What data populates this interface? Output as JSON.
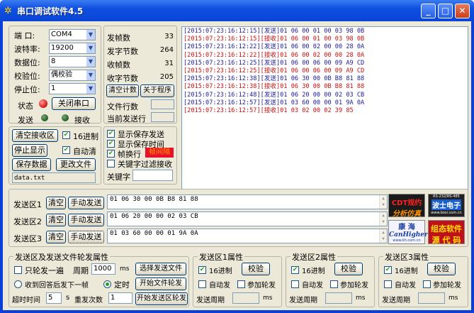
{
  "window": {
    "title": "串口调试软件4.5",
    "icon": "app-icon"
  },
  "port": {
    "labels": {
      "port": "端  口:",
      "baud": "波特率:",
      "databits": "数据位:",
      "parity": "校验位:",
      "stopbits": "停止位:",
      "state": "状态",
      "send": "发送",
      "recv": "接收"
    },
    "values": {
      "port": "COM4",
      "baud": "19200",
      "databits": "8",
      "parity": "偶校验",
      "stopbits": "1"
    },
    "close_button": "关闭串口",
    "state_color": "#e02020",
    "led_color": "#2a6a2a"
  },
  "stats": {
    "send_frames_label": "发帧数",
    "send_frames": "33",
    "send_bytes_label": "发字节数",
    "send_bytes": "264",
    "recv_frames_label": "收帧数",
    "recv_frames": "31",
    "recv_bytes_label": "收字节数",
    "recv_bytes": "205",
    "clear_button": "清空计数",
    "about_button": "关于程序",
    "file_lines_label": "文件行数",
    "current_line_label": "当前发送行"
  },
  "recv_controls": {
    "clear_recv": "清空接收区",
    "hex16": "16进制",
    "stop_display": "停止显示",
    "auto_clear": "自动清",
    "save_data": "保存数据",
    "change_file": "更改文件",
    "filename": "data.txt"
  },
  "display_options": {
    "show_save_send": "显示保存发送",
    "show_save_time": "显示保存时间",
    "frame_newline": "帧换行",
    "frame_newline_badge": "帧间隔",
    "keyword_filter": "关键字过滤接收",
    "keyword_label": "关键字"
  },
  "log": [
    {
      "text": "[2015:07:23:16:12:15][发送]01 06 00 01 00 03 98 0B",
      "color": "#1a1a9a"
    },
    {
      "text": "[2015:07:23:16:12:15][接收]01 06 00 01 00 03 98 0B",
      "color": "#c81010"
    },
    {
      "text": "[2015:07:23:16:12:22][发送]01 06 00 02 00 00 28 0A",
      "color": "#1a1a9a"
    },
    {
      "text": "[2015:07:23:16:12:22][接收]01 06 00 02 00 00 28 0A",
      "color": "#c81010"
    },
    {
      "text": "[2015:07:23:16:12:25][发送]01 06 00 06 00 09 A9 CD",
      "color": "#1a1a9a"
    },
    {
      "text": "[2015:07:23:16:12:25][接收]01 06 00 06 00 09 A9 CD",
      "color": "#c81010"
    },
    {
      "text": "[2015:07:23:16:12:38][发送]01 06 30 00 0B B8 81 88",
      "color": "#1a1a9a"
    },
    {
      "text": "[2015:07:23:16:12:38][接收]01 06 30 00 0B B8 81 88",
      "color": "#c81010"
    },
    {
      "text": "[2015:07:23:16:12:48][发送]01 06 20 00 00 02 03 CB",
      "color": "#1a1a9a"
    },
    {
      "text": "[2015:07:23:16:12:57][发送]01 03 60 00 00 01 9A 0A",
      "color": "#1a1a9a"
    },
    {
      "text": "[2015:07:23:16:12:57][接收]01 03 02 00 02 39 85",
      "color": "#c81010"
    }
  ],
  "send_areas": [
    {
      "label": "发送区1",
      "clear": "清空",
      "manual": "手动发送",
      "content": "01  06  30  00  0B  B8  81  88"
    },
    {
      "label": "发送区2",
      "clear": "清空",
      "manual": "手动发送",
      "content": "01  06  20  00  00  02  03  CB"
    },
    {
      "label": "发送区3",
      "clear": "清空",
      "manual": "手动发送",
      "content": "01  03  60  00  00  01  9A  0A"
    }
  ],
  "ads": {
    "cdt_line1": "CDT规约",
    "cdt_line2": "分析仿真",
    "rs_line1": "RS-232/RS-485",
    "rs_line2": "波士电子",
    "rs_line3": "www.bosi.com.cn",
    "kh_line1": "康 海",
    "kh_line2": "CanHigher",
    "kh_line3": "www.kh.com.cn",
    "soft_line1": "组态软件",
    "soft_line2": "源 代 码"
  },
  "poll": {
    "group": "发送区及发送文件轮发属性",
    "once": "只轮发一遍",
    "period_label": "周期",
    "period": "1000",
    "ms": "ms",
    "select_file": "选择发送文件",
    "recv_reply": "收到回答后发下一帧",
    "timed": "定时",
    "start_file": "开始文件轮发",
    "timeout_label": "超时时间",
    "timeout": "5",
    "s": "s",
    "retry_label": "重发次数",
    "retry": "1",
    "start_area": "开始发送区轮发"
  },
  "area_props": [
    {
      "group": "发送区1属性",
      "hex16": "16进制",
      "check": "校验",
      "auto": "自动发",
      "join": "参加轮发",
      "period_label": "发送周期",
      "ms": "ms"
    },
    {
      "group": "发送区2属性",
      "hex16": "16进制",
      "check": "校验",
      "auto": "自动发",
      "join": "参加轮发",
      "period_label": "发送周期",
      "ms": "ms"
    },
    {
      "group": "发送区3属性",
      "hex16": "16进制",
      "check": "校验",
      "auto": "自动发",
      "join": "参加轮发",
      "period_label": "发送周期",
      "ms": "ms"
    }
  ]
}
